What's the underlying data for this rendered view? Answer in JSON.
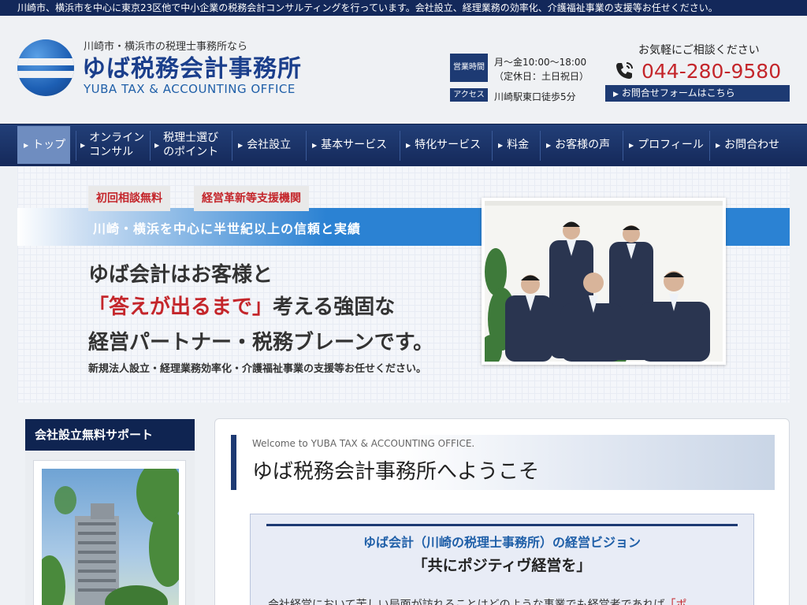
{
  "topbar": {
    "text": "川崎市、横浜市を中心に東京23区他で中小企業の税務会計コンサルティングを行っています。会社設立、経理業務の効率化、介護福祉事業の支援等お任せください。"
  },
  "header": {
    "logo_sub": "川崎市・横浜市の税理士事務所なら",
    "logo_title": "ゆば税務会計事務所",
    "logo_en": "YUBA TAX & ACCOUNTING OFFICE",
    "hours_label": "営業時間",
    "hours_line1": "月～金10:00～18:00",
    "hours_line2": "（定休日：土日祝日）",
    "access_label": "アクセス",
    "access_text": "川崎駅東口徒歩5分",
    "contact_lead": "お気軽にご相談ください",
    "phone": "044-280-9580",
    "form_link": "お問合せフォームはこちら"
  },
  "nav": {
    "items": [
      {
        "line1": "トップ",
        "line2": ""
      },
      {
        "line1": "オンライン",
        "line2": "コンサル"
      },
      {
        "line1": "税理士選び",
        "line2": "のポイント"
      },
      {
        "line1": "会社設立",
        "line2": ""
      },
      {
        "line1": "基本サービス",
        "line2": ""
      },
      {
        "line1": "特化サービス",
        "line2": ""
      },
      {
        "line1": "料金",
        "line2": ""
      },
      {
        "line1": "お客様の声",
        "line2": ""
      },
      {
        "line1": "プロフィール",
        "line2": ""
      },
      {
        "line1": "お問合わせ",
        "line2": ""
      }
    ],
    "active_index": 0
  },
  "hero": {
    "badge1": "初回相談無料",
    "badge2": "経営革新等支援機関",
    "band": "川崎・横浜を中心に半世紀以上の信頼と実績",
    "line1": "ゆば会計はお客様と",
    "line2_red": "「答えが出るまで」",
    "line2_rest": "考える強固な",
    "line3": "経営パートナー・税務ブレーンです。",
    "sub": "新規法人設立・経理業務効率化・介護福祉事業の支援等お任せください。"
  },
  "sidebar": {
    "heading": "会社設立無料サポート"
  },
  "main": {
    "welcome_en": "Welcome to YUBA TAX & ACCOUNTING OFFICE.",
    "welcome_ja": "ゆば税務会計事務所へようこそ",
    "vision_title": "ゆば会計（川崎の税理士事務所）の経営ビジョン",
    "vision_motto": "「共にポジティヴ経営を」",
    "body_text": "会社経営において苦しい局面が訪れることはどのような事業でも経営者であれば",
    "body_red": "「ポ"
  },
  "colors": {
    "navy": "#13285a",
    "accent_blue": "#1f5fa8",
    "phone_red": "#c4262b",
    "band_blue": "#2b82d3"
  }
}
